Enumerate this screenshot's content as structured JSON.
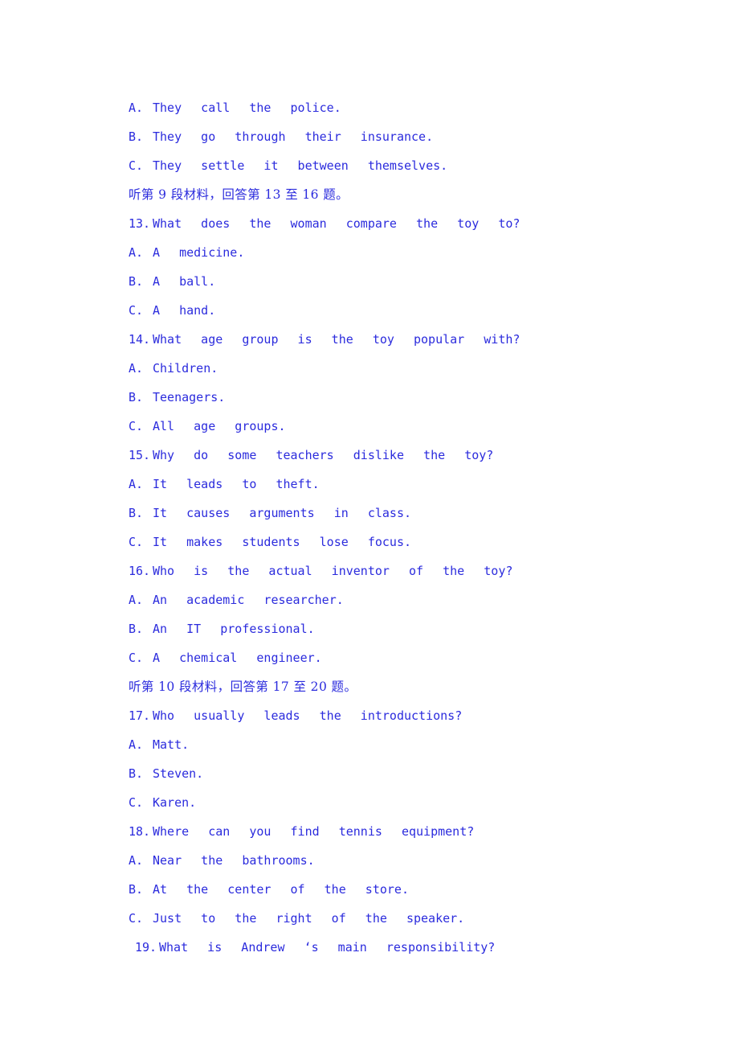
{
  "document": {
    "language_primary": "en",
    "language_secondary": "zh",
    "text_color": "#2b2bdd",
    "background_color": "#ffffff",
    "lines": [
      {
        "kind": "option",
        "label": "A.",
        "text": "They  call  the  police."
      },
      {
        "kind": "option",
        "label": "B.",
        "text": "They  go  through  their  insurance."
      },
      {
        "kind": "option",
        "label": "C.",
        "text": "They  settle  it  between  themselves."
      },
      {
        "kind": "section",
        "label": "",
        "text": "听第 9 段材料，回答第 13 至 16 题。"
      },
      {
        "kind": "question",
        "label": "13.",
        "text": "What  does  the  woman  compare  the  toy  to?"
      },
      {
        "kind": "option",
        "label": "A.",
        "text": "A  medicine."
      },
      {
        "kind": "option",
        "label": "B.",
        "text": "A  ball."
      },
      {
        "kind": "option",
        "label": "C.",
        "text": "A  hand."
      },
      {
        "kind": "question",
        "label": "14.",
        "text": "What  age  group  is  the  toy  popular  with?"
      },
      {
        "kind": "option",
        "label": "A.",
        "text": "Children."
      },
      {
        "kind": "option",
        "label": "B.",
        "text": "Teenagers."
      },
      {
        "kind": "option",
        "label": "C.",
        "text": "All  age  groups."
      },
      {
        "kind": "question",
        "label": "15.",
        "text": "Why  do  some  teachers  dislike  the  toy?"
      },
      {
        "kind": "option",
        "label": "A.",
        "text": "It  leads  to  theft."
      },
      {
        "kind": "option",
        "label": "B.",
        "text": "It  causes  arguments  in  class."
      },
      {
        "kind": "option",
        "label": "C.",
        "text": "It  makes  students  lose  focus."
      },
      {
        "kind": "question",
        "label": "16.",
        "text": "Who  is  the  actual  inventor  of  the  toy?"
      },
      {
        "kind": "option",
        "label": "A.",
        "text": "An  academic  researcher."
      },
      {
        "kind": "option",
        "label": "B.",
        "text": "An  IT  professional."
      },
      {
        "kind": "option",
        "label": "C.",
        "text": "A  chemical  engineer."
      },
      {
        "kind": "section",
        "label": "",
        "text": "听第 10 段材料，回答第 17 至 20 题。"
      },
      {
        "kind": "question",
        "label": "17.",
        "text": "Who  usually  leads  the  introductions?"
      },
      {
        "kind": "option",
        "label": "A.",
        "text": "Matt."
      },
      {
        "kind": "option",
        "label": "B.",
        "text": "Steven."
      },
      {
        "kind": "option",
        "label": "C.",
        "text": "Karen."
      },
      {
        "kind": "question",
        "label": "18.",
        "text": "Where  can  you  find  tennis  equipment?"
      },
      {
        "kind": "option",
        "label": "A.",
        "text": "Near  the  bathrooms."
      },
      {
        "kind": "option",
        "label": "B.",
        "text": "At  the  center  of  the  store."
      },
      {
        "kind": "option",
        "label": "C.",
        "text": "Just  to  the  right  of  the  speaker."
      },
      {
        "kind": "question",
        "label": "19.",
        "text": "What  is  Andrew  ‘s  main  responsibility?",
        "indent": true
      }
    ]
  }
}
